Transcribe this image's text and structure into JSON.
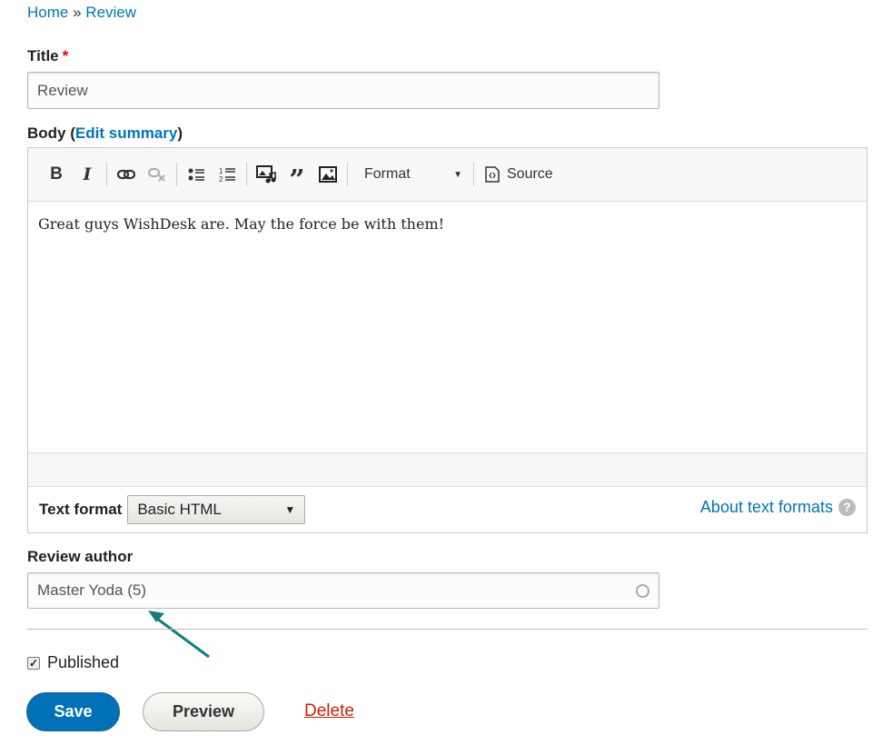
{
  "breadcrumb": {
    "home": "Home",
    "separator": "»",
    "current": "Review"
  },
  "title_field": {
    "label": "Title",
    "required_mark": "*",
    "value": "Review"
  },
  "body_field": {
    "label": "Body",
    "paren_open": "(",
    "edit_summary": "Edit summary",
    "paren_close": ")",
    "toolbar": {
      "format_label": "Format",
      "source_label": "Source"
    },
    "content": "Great guys WishDesk are. May the force be with them!",
    "text_format_label": "Text format",
    "text_format_value": "Basic HTML",
    "about_link": "About text formats"
  },
  "review_author": {
    "label": "Review author",
    "value": "Master Yoda (5)"
  },
  "published": {
    "label": "Published",
    "checked": true
  },
  "actions": {
    "save": "Save",
    "preview": "Preview",
    "delete": "Delete"
  },
  "colors": {
    "link": "#0074bd",
    "primary": "#0071b8",
    "delete": "#c72100",
    "arrow": "#127f7a"
  }
}
